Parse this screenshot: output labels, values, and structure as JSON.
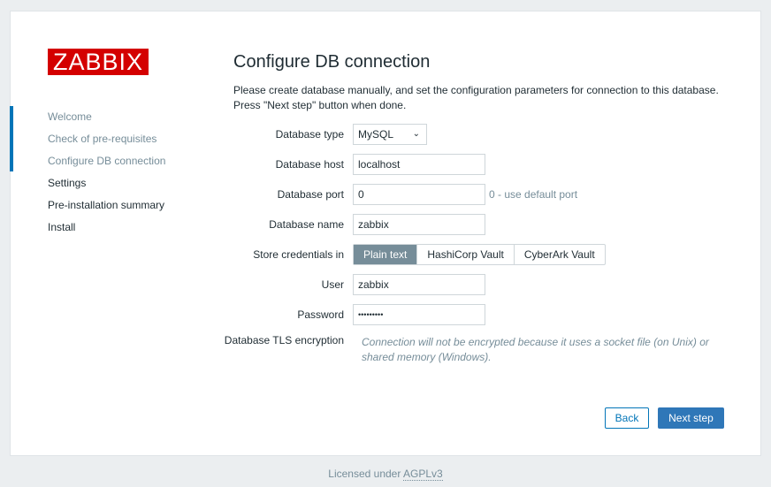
{
  "logo": "ZABBIX",
  "nav": [
    {
      "label": "Welcome",
      "done": true
    },
    {
      "label": "Check of pre-requisites",
      "done": true
    },
    {
      "label": "Configure DB connection",
      "done": true
    },
    {
      "label": "Settings",
      "done": false
    },
    {
      "label": "Pre-installation summary",
      "done": false
    },
    {
      "label": "Install",
      "done": false
    }
  ],
  "title": "Configure DB connection",
  "desc1": "Please create database manually, and set the configuration parameters for connection to this database.",
  "desc2": "Press \"Next step\" button when done.",
  "form": {
    "db_type": {
      "label": "Database type",
      "value": "MySQL"
    },
    "db_host": {
      "label": "Database host",
      "value": "localhost"
    },
    "db_port": {
      "label": "Database port",
      "value": "0",
      "hint": "0 - use default port"
    },
    "db_name": {
      "label": "Database name",
      "value": "zabbix"
    },
    "store": {
      "label": "Store credentials in",
      "options": [
        "Plain text",
        "HashiCorp Vault",
        "CyberArk Vault"
      ],
      "selected": "Plain text"
    },
    "user": {
      "label": "User",
      "value": "zabbix"
    },
    "password": {
      "label": "Password",
      "value": "•••••••••"
    },
    "tls": {
      "label": "Database TLS encryption",
      "text": "Connection will not be encrypted because it uses a socket file (on Unix) or shared memory (Windows)."
    }
  },
  "buttons": {
    "back": "Back",
    "next": "Next step"
  },
  "footer": {
    "prefix": "Licensed under ",
    "link": "AGPLv3"
  },
  "colors": {
    "brand": "#d40000",
    "accent": "#2f77b8"
  }
}
